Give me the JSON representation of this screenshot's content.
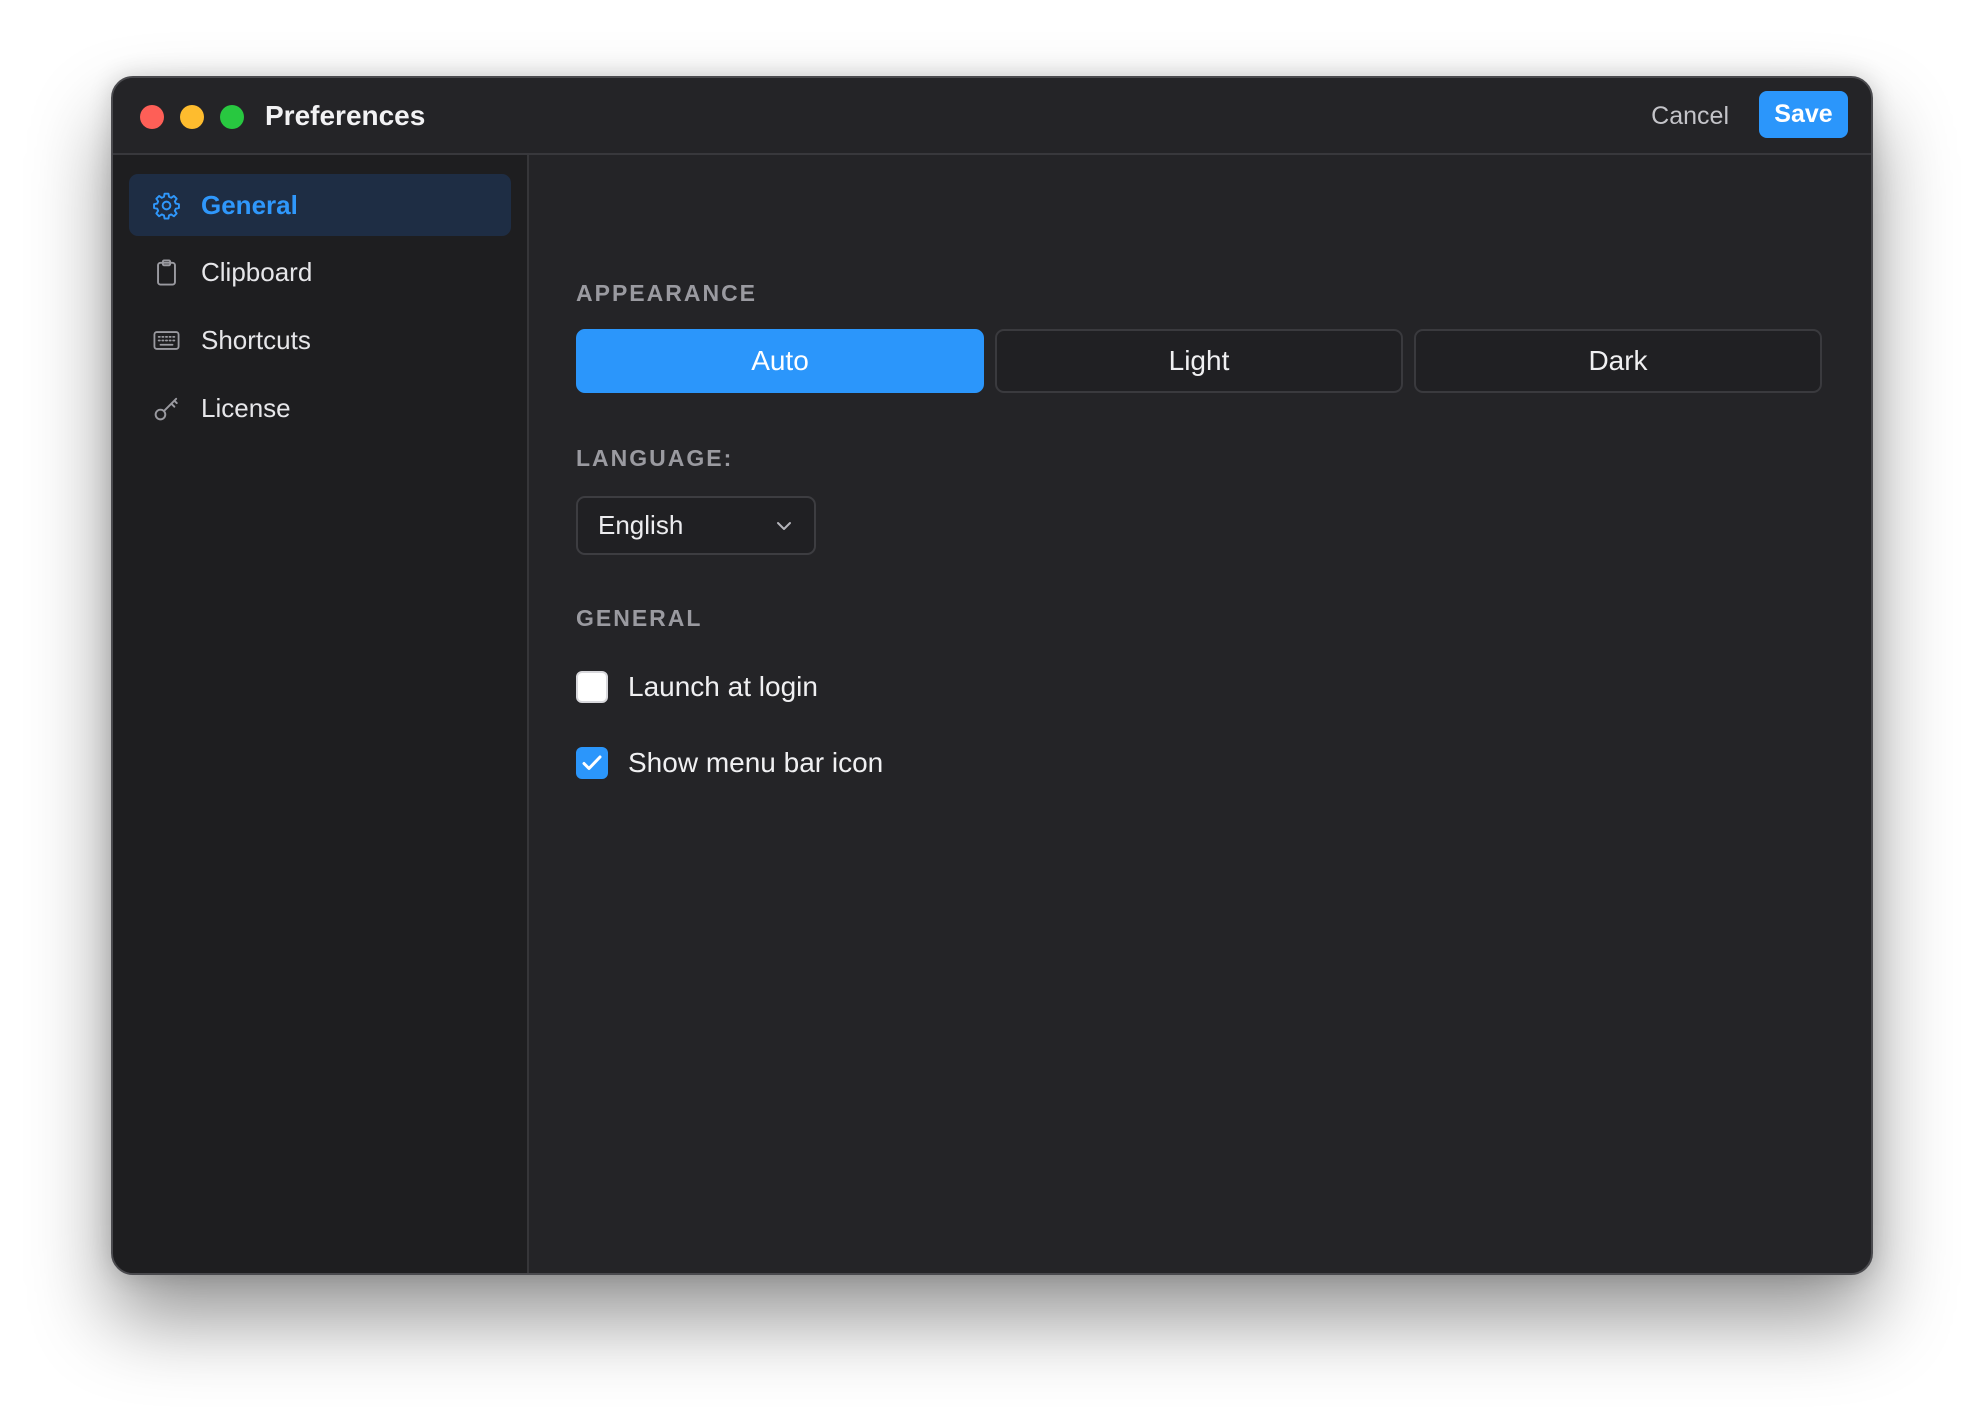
{
  "window": {
    "title": "Preferences",
    "cancel_label": "Cancel",
    "save_label": "Save"
  },
  "sidebar": {
    "items": [
      {
        "label": "General",
        "icon": "gear-icon",
        "active": true
      },
      {
        "label": "Clipboard",
        "icon": "clipboard-icon",
        "active": false
      },
      {
        "label": "Shortcuts",
        "icon": "keyboard-icon",
        "active": false
      },
      {
        "label": "License",
        "icon": "key-icon",
        "active": false
      }
    ]
  },
  "appearance": {
    "heading": "APPEARANCE",
    "options": [
      "Auto",
      "Light",
      "Dark"
    ],
    "selected": "Auto"
  },
  "language": {
    "heading": "LANGUAGE:",
    "value": "English"
  },
  "general": {
    "heading": "GENERAL",
    "launch_at_login": {
      "label": "Launch at login",
      "checked": false
    },
    "show_menu_bar_icon": {
      "label": "Show menu bar icon",
      "checked": true
    }
  },
  "colors": {
    "accent": "#2b96fb",
    "window_bg": "#242427",
    "sidebar_bg": "#1e1e20",
    "active_nav_bg": "#1e2d44",
    "traffic_close": "#fe5f57",
    "traffic_minimize": "#febc2e",
    "traffic_zoom": "#28c840"
  }
}
